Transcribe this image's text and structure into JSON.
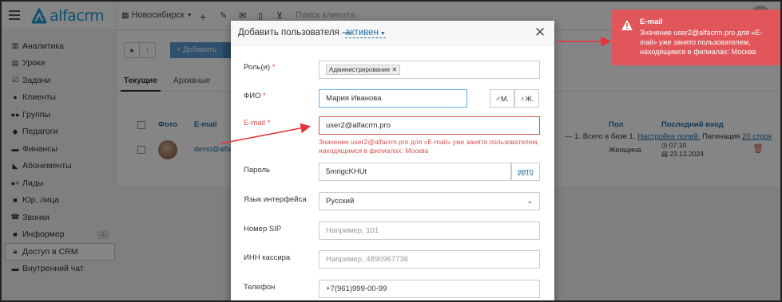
{
  "topbar": {
    "logo_text": "alfacrm",
    "branch": "Новосибирск",
    "search_placeholder": "Поиск клиента"
  },
  "sidebar": {
    "items": [
      {
        "label": "Аналитика",
        "icon": "chart-icon"
      },
      {
        "label": "Уроки",
        "icon": "calendar-icon"
      },
      {
        "label": "Задачи",
        "icon": "tasks-icon"
      },
      {
        "label": "Клиенты",
        "icon": "user-icon"
      },
      {
        "label": "Группы",
        "icon": "users-icon"
      },
      {
        "label": "Педагоги",
        "icon": "graduation-cap-icon"
      },
      {
        "label": "Финансы",
        "icon": "money-icon"
      },
      {
        "label": "Абонементы",
        "icon": "tag-icon"
      },
      {
        "label": "Лиды",
        "icon": "user-plus-icon"
      },
      {
        "label": "Юр. лица",
        "icon": "briefcase-icon"
      },
      {
        "label": "Звонки",
        "icon": "phone-icon"
      },
      {
        "label": "Информер",
        "icon": "monitor-icon",
        "badge": "1"
      },
      {
        "label": "Доступ в CRM",
        "icon": "lock-icon"
      },
      {
        "label": "Внутренний чат",
        "icon": "chat-icon"
      }
    ]
  },
  "main": {
    "add_button": "+ Добавить",
    "tabs": [
      "Текущие",
      "Архивные"
    ],
    "columns": {
      "photo": "Фото",
      "email": "E-mail",
      "gender": "Пол",
      "last_login": "Последний вход"
    },
    "pager_text": "— 1. Всего в базе 1.",
    "field_settings_link": "Настройка полей.",
    "pagination_label": "Пагинация",
    "pagination_value": "20 строк",
    "row": {
      "email": "demo@alfa",
      "gender": "Женщина",
      "last_login_time": "07:10",
      "last_login_date": "23.12.2024"
    }
  },
  "modal": {
    "title": "Добавить пользователя —",
    "status": "активен",
    "roles_label": "Роль(и)",
    "role_tag": "Администрирование",
    "name_label": "ФИО",
    "name_value": "Мария Иванова",
    "gender_m": "М.",
    "gender_f": "Ж.",
    "email_label": "E-mail",
    "email_value": "user2@alfacrm.pro",
    "email_error": "Значение user2@alfacrm.pro для «E-mail» уже занято пользователем, находящимся в филиалах: Москва",
    "password_label": "Пароль",
    "password_value": "5mrigcKHUt",
    "password_auto": "авто",
    "language_label": "Язык интерфейса",
    "language_value": "Русский",
    "sip_label": "Номер SIP",
    "sip_placeholder": "Например, 101",
    "inn_label": "ИНН кассира",
    "inn_placeholder": "Например, 4890967736",
    "phone_label": "Телефон",
    "phone_value": "+7(961)999-00-99",
    "required_mark": "*"
  },
  "toast": {
    "title": "E-mail",
    "body": "Значение user2@alfacrm.pro для «E-mail» уже занято пользователем, находящимся в филиалах: Москва"
  },
  "colors": {
    "accent": "#1e9bd8",
    "error": "#d9534f",
    "toast_bg": "#e0565b",
    "arrow": "#e8333a"
  }
}
